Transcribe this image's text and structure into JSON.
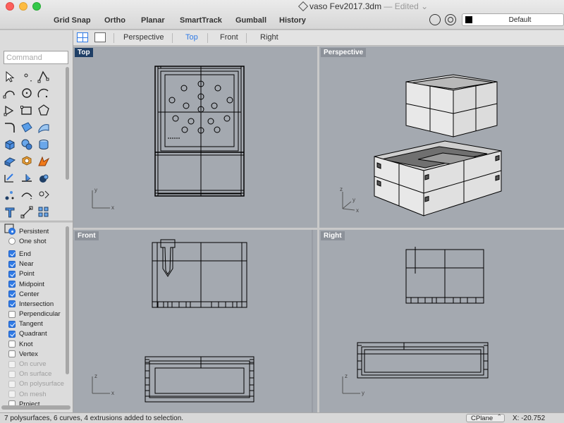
{
  "window": {
    "title": "vaso Fev2017.3dm",
    "edited_label": "— Edited ⌄"
  },
  "toolbar": {
    "modes": [
      "Grid Snap",
      "Ortho",
      "Planar",
      "SmartTrack",
      "Gumball",
      "History"
    ],
    "layer": "Default",
    "layer_color": "#000000"
  },
  "command": {
    "placeholder": "Command"
  },
  "viewport_tabs": [
    "Perspective",
    "Top",
    "Front",
    "Right"
  ],
  "active_tab": "Top",
  "viewports": {
    "top": "Top",
    "perspective": "Perspective",
    "front": "Front",
    "right": "Right"
  },
  "osnap": {
    "radios": [
      {
        "label": "Persistent",
        "selected": true
      },
      {
        "label": "One shot",
        "selected": false
      }
    ],
    "items": [
      {
        "label": "End",
        "checked": true,
        "enabled": true
      },
      {
        "label": "Near",
        "checked": true,
        "enabled": true
      },
      {
        "label": "Point",
        "checked": true,
        "enabled": true
      },
      {
        "label": "Midpoint",
        "checked": true,
        "enabled": true
      },
      {
        "label": "Center",
        "checked": true,
        "enabled": true
      },
      {
        "label": "Intersection",
        "checked": true,
        "enabled": true
      },
      {
        "label": "Perpendicular",
        "checked": false,
        "enabled": true
      },
      {
        "label": "Tangent",
        "checked": true,
        "enabled": true
      },
      {
        "label": "Quadrant",
        "checked": true,
        "enabled": true
      },
      {
        "label": "Knot",
        "checked": false,
        "enabled": true
      },
      {
        "label": "Vertex",
        "checked": false,
        "enabled": true
      },
      {
        "label": "On curve",
        "checked": false,
        "enabled": false
      },
      {
        "label": "On surface",
        "checked": false,
        "enabled": false
      },
      {
        "label": "On polysurface",
        "checked": false,
        "enabled": false
      },
      {
        "label": "On mesh",
        "checked": false,
        "enabled": false
      },
      {
        "label": "Project",
        "checked": false,
        "enabled": true
      }
    ]
  },
  "statusbar": {
    "message": "7 polysurfaces, 6 curves, 4 extrusions added to selection.",
    "cplane": "CPlane",
    "coordinate": "X: -20.752"
  },
  "axis": {
    "x": "x",
    "y": "y",
    "z": "z"
  },
  "colors": {
    "accent": "#2f7ae5",
    "viewport_bg": "#a4a9b0",
    "active_label_bg": "#1f3f66"
  }
}
